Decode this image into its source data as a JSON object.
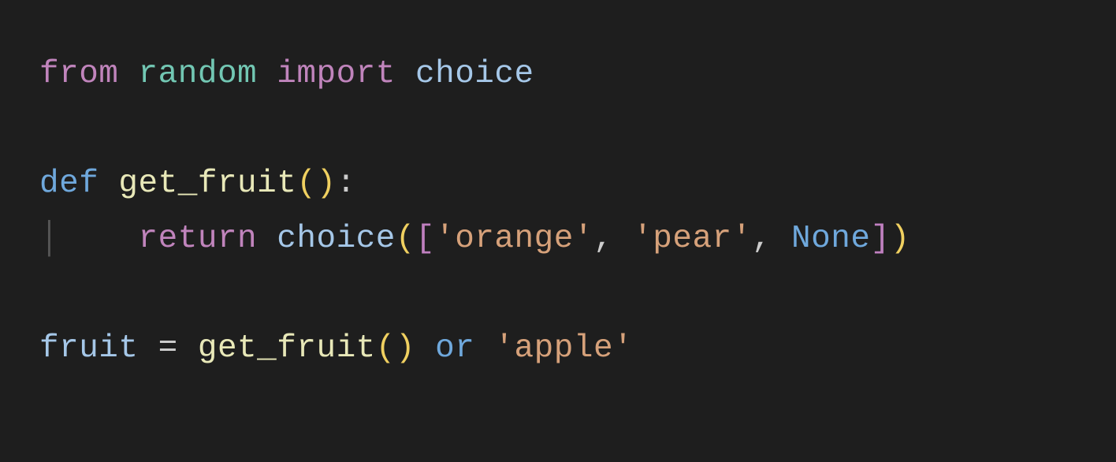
{
  "code": {
    "line1": {
      "from": "from",
      "module": "random",
      "import": "import",
      "name": "choice"
    },
    "line3": {
      "def": "def",
      "fn": "get_fruit",
      "lp": "(",
      "rp": ")",
      "colon": ":"
    },
    "line4": {
      "return": "return",
      "call": "choice",
      "lp": "(",
      "lb": "[",
      "s1q1": "'",
      "s1": "orange",
      "s1q2": "'",
      "c1": ",",
      "sp1": " ",
      "s2q1": "'",
      "s2": "pear",
      "s2q2": "'",
      "c2": ",",
      "sp2": " ",
      "none": "None",
      "rb": "]",
      "rp": ")"
    },
    "line6": {
      "var": "fruit",
      "eq": " = ",
      "fn": "get_fruit",
      "lp": "(",
      "rp": ")",
      "sp": " ",
      "or": "or",
      "sp2": " ",
      "sq1": "'",
      "s": "apple",
      "sq2": "'"
    },
    "indent_guide": "│",
    "indent_spaces": "    "
  }
}
